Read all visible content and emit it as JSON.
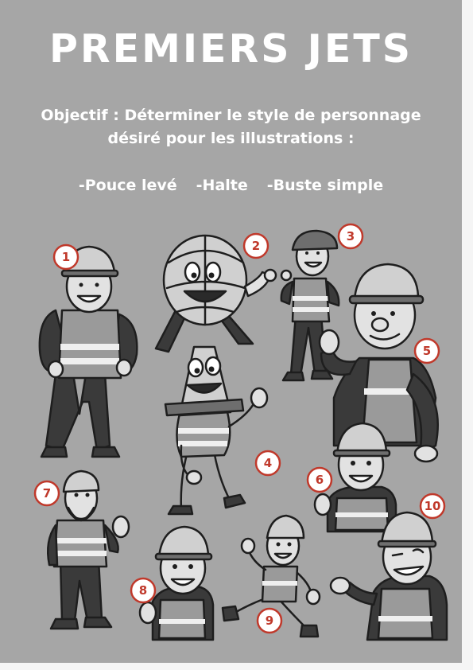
{
  "title": "PREMIERS JETS",
  "objective": {
    "line1": "Objectif : Déterminer le style de personnage",
    "line2": "désiré pour les illustrations :"
  },
  "styles": [
    "-Pouce levé",
    "-Halte",
    "-Buste simple"
  ],
  "characters": [
    {
      "number": "1",
      "description": "construction worker, hands on hips"
    },
    {
      "number": "2",
      "description": "round helmet character, thumbs up"
    },
    {
      "number": "3",
      "description": "small worker in cap, thumbs up"
    },
    {
      "number": "4",
      "description": "traffic cone character with vest, thumbs up"
    },
    {
      "number": "5",
      "description": "large worker bust, thumbs up"
    },
    {
      "number": "6",
      "description": "worker bust with helmet, thumbs up"
    },
    {
      "number": "7",
      "description": "bearded worker, hand raised"
    },
    {
      "number": "8",
      "description": "worker bust, thumbs up"
    },
    {
      "number": "9",
      "description": "running worker, waving"
    },
    {
      "number": "10",
      "description": "winking worker bust, thumbs up"
    }
  ],
  "colors": {
    "background": "#a6a6a6",
    "text": "#ffffff",
    "badge_stroke": "#c0392b",
    "badge_fill": "#ffffff"
  }
}
